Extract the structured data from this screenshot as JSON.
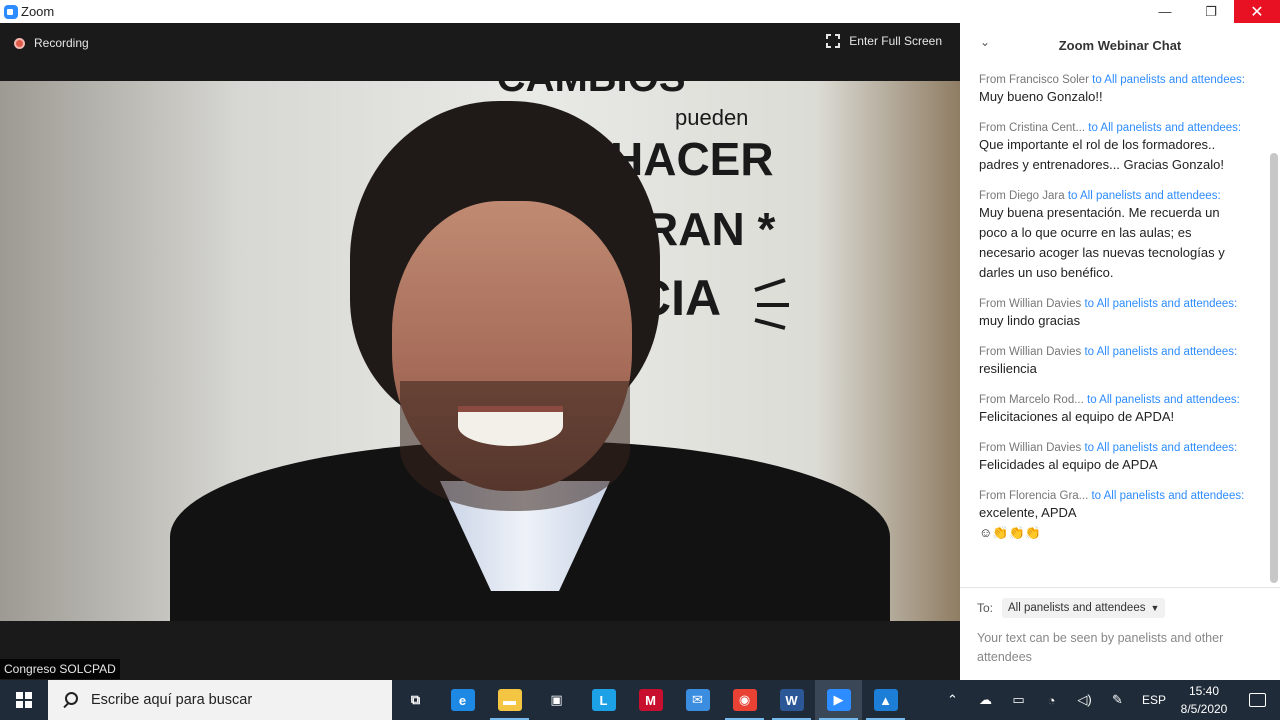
{
  "window": {
    "title": "Zoom",
    "minimize_glyph": "—",
    "maximize_glyph": "❐",
    "close_glyph": "✕"
  },
  "meeting": {
    "recording_label": "Recording",
    "fullscreen_label": "Enter Full Screen",
    "participant_name": "Congreso SOLCPAD"
  },
  "chat": {
    "title": "Zoom Webinar Chat",
    "messages": [
      {
        "from": "From Francisco Soler",
        "to": "to All panelists and attendees:",
        "text": "Muy bueno Gonzalo!!"
      },
      {
        "from": "From Cristina Cent...",
        "to": "to All panelists and attendees:",
        "text": "Que importante el rol de los formadores.. padres y entrenadores... Gracias Gonzalo!"
      },
      {
        "from": "From Diego Jara",
        "to": "to All panelists and attendees:",
        "text": "Muy buena presentación. Me recuerda un poco a lo que ocurre en las aulas; es necesario acoger las nuevas tecnologías y darles un uso benéfico."
      },
      {
        "from": "From Willian Davies",
        "to": "to All panelists and attendees:",
        "text": "muy lindo gracias"
      },
      {
        "from": "From Willian Davies",
        "to": "to All panelists and attendees:",
        "text": "resiliencia"
      },
      {
        "from": "From Marcelo Rod...",
        "to": "to All panelists and attendees:",
        "text": "Felicitaciones al equipo de APDA!"
      },
      {
        "from": "From Willian Davies",
        "to": "to All panelists and attendees:",
        "text": "Felicidades al equipo de APDA"
      },
      {
        "from": "From Florencia Gra...",
        "to": "to All panelists and attendees:",
        "text": "excelente, APDA",
        "emoji": "☺👏👏👏"
      }
    ],
    "to_label": "To:",
    "to_value": "All panelists and attendees",
    "input_placeholder": "Your text can be seen by panelists and other attendees"
  },
  "taskbar": {
    "search_placeholder": "Escribe aquí para buscar",
    "apps": [
      {
        "name": "task-view",
        "glyph": "⧉",
        "color": "transparent",
        "active": false,
        "running": false
      },
      {
        "name": "edge",
        "glyph": "e",
        "color": "#1e88e5",
        "active": false,
        "running": false
      },
      {
        "name": "file-explorer",
        "glyph": "▬",
        "color": "#f4c542",
        "active": false,
        "running": true
      },
      {
        "name": "store",
        "glyph": "▣",
        "color": "transparent",
        "active": false,
        "running": false
      },
      {
        "name": "l-app",
        "glyph": "L",
        "color": "#1ca0e6",
        "active": false,
        "running": false
      },
      {
        "name": "mcafee",
        "glyph": "M",
        "color": "#c8102e",
        "active": false,
        "running": false
      },
      {
        "name": "mail",
        "glyph": "✉",
        "color": "#3b8de0",
        "active": false,
        "running": false
      },
      {
        "name": "chrome",
        "glyph": "◉",
        "color": "#e94235",
        "active": false,
        "running": true
      },
      {
        "name": "word",
        "glyph": "W",
        "color": "#2b5797",
        "active": false,
        "running": true
      },
      {
        "name": "zoom",
        "glyph": "▶",
        "color": "#2d8cff",
        "active": true,
        "running": true
      },
      {
        "name": "photos",
        "glyph": "▲",
        "color": "#1c7ed6",
        "active": false,
        "running": true
      }
    ],
    "lang": "ESP",
    "time": "15:40",
    "date": "8/5/2020"
  }
}
